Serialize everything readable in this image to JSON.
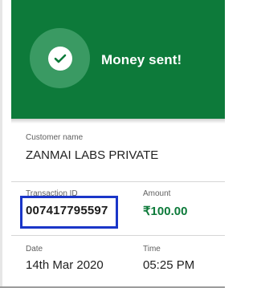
{
  "header": {
    "title": "Money sent!",
    "icon": "check-circle-icon",
    "background_color": "#0d7a3a"
  },
  "customer": {
    "label": "Customer name",
    "value": "ZANMAI LABS PRIVATE"
  },
  "transaction": {
    "label": "Transaction ID",
    "value": "007417795597",
    "highlight_color": "#1a36c8"
  },
  "amount": {
    "label": "Amount",
    "value": "₹100.00",
    "color": "#0d7a3a"
  },
  "date": {
    "label": "Date",
    "value": "14th Mar 2020"
  },
  "time": {
    "label": "Time",
    "value": "05:25 PM"
  }
}
